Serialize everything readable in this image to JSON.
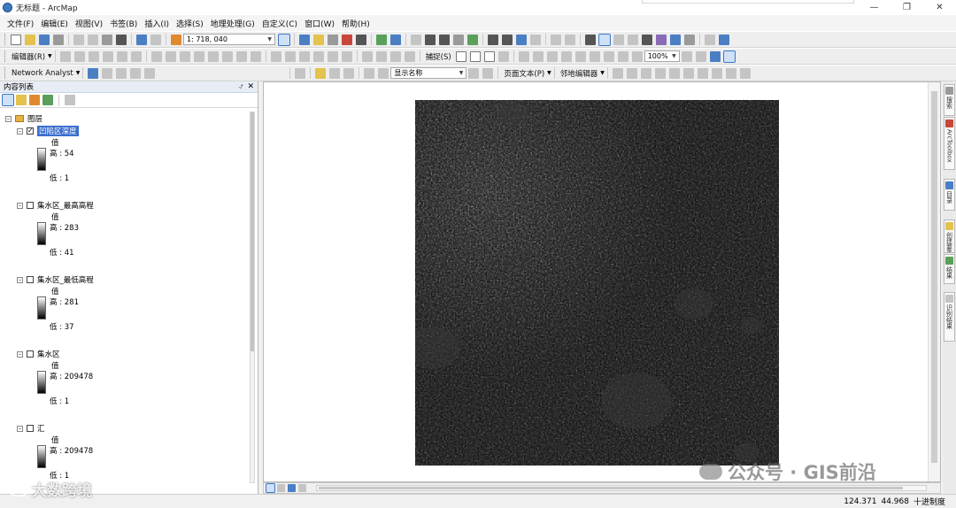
{
  "window": {
    "title": "无标题 - ArcMap"
  },
  "menubar": [
    "文件(F)",
    "编辑(E)",
    "视图(V)",
    "书签(B)",
    "插入(I)",
    "选择(S)",
    "地理处理(G)",
    "自定义(C)",
    "窗口(W)",
    "帮助(H)"
  ],
  "toolbar1": {
    "scale": "1: 718, 040"
  },
  "toolbar2": {
    "editor_label": "编辑器(R)",
    "snapping_label": "捕捉(S)",
    "zoom_value": "100%"
  },
  "toolbar3": {
    "network_label": "Network Analyst",
    "display_field": "显示名称",
    "page_text_label": "页面文本(P)",
    "adjacent_editor_label": "邻地编辑器"
  },
  "toc": {
    "title": "内容列表",
    "root": "图层",
    "value_label": "值",
    "layers": [
      {
        "name": "凹陷区深度",
        "checked": true,
        "high": "高 : 54",
        "low": "低 : 1"
      },
      {
        "name": "集水区_最高高程",
        "checked": false,
        "high": "高 : 283",
        "low": "低 : 41"
      },
      {
        "name": "集水区_最低高程",
        "checked": false,
        "high": "高 : 281",
        "low": "低 : 37"
      },
      {
        "name": "集水区",
        "checked": false,
        "high": "高 : 209478",
        "low": "低 : 1"
      },
      {
        "name": "汇",
        "checked": false,
        "high": "高 : 209478",
        "low": "低 : 1"
      }
    ]
  },
  "right_dock": [
    "搜索",
    "ArcToolbox",
    "目录",
    "创建要素",
    "结果",
    "识别结果"
  ],
  "status": {
    "x": "124.371",
    "y": "44.968",
    "units": "十进制度"
  },
  "watermarks": {
    "left": "大数跨境",
    "right": "公众号 · GIS前沿"
  },
  "colors": {
    "selection": "#3b6fce",
    "raster_bg": "#151515"
  }
}
